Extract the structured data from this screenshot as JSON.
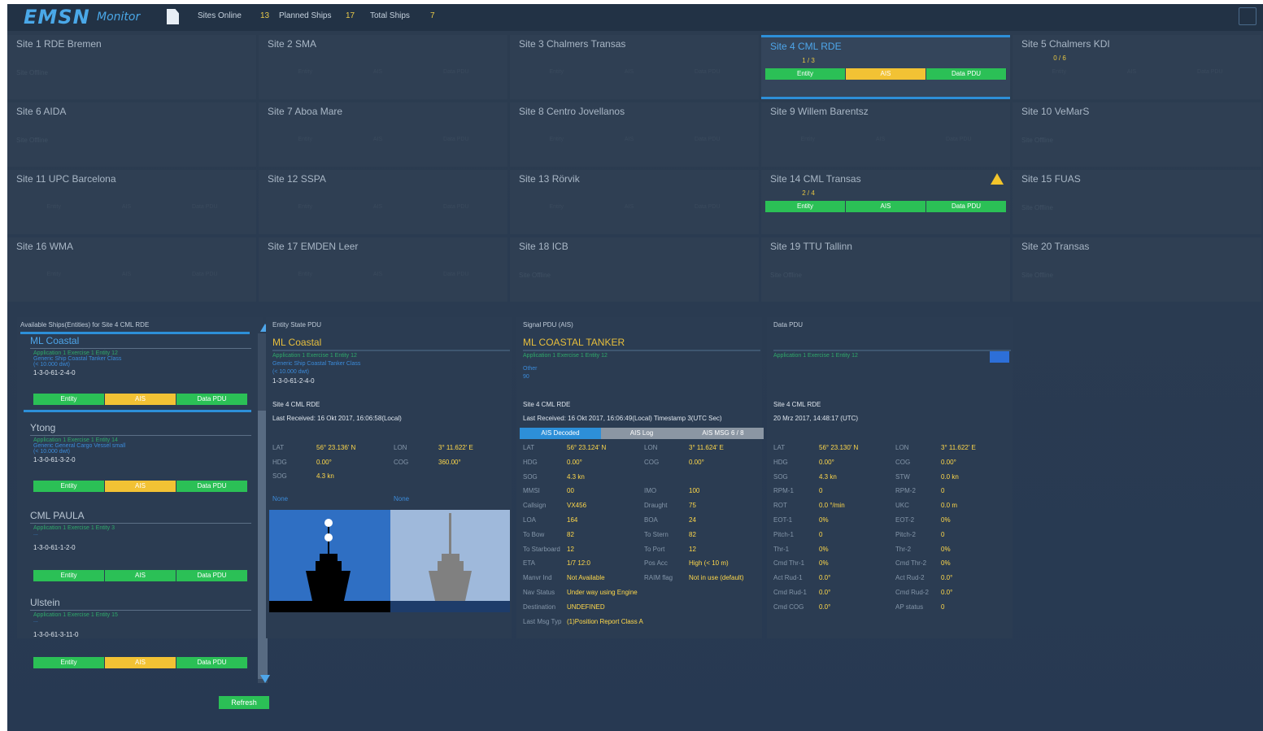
{
  "app": {
    "logo": "EMSN",
    "logo_sub": "Monitor",
    "stats": [
      {
        "label": "Sites Online",
        "value": "13"
      },
      {
        "label": "Planned Ships",
        "value": "17"
      },
      {
        "label": "Total Ships",
        "value": "7"
      }
    ]
  },
  "sites": [
    {
      "name": "Site 1 RDE Bremen",
      "status": "Site Offline"
    },
    {
      "name": "Site 2 SMA",
      "ghost": [
        "Entity",
        "AIS",
        "Data PDU"
      ]
    },
    {
      "name": "Site 3 Chalmers Transas",
      "ghost": [
        "Entity",
        "AIS",
        "Data PDU"
      ]
    },
    {
      "name": "Site 4 CML RDE",
      "frac": "1 / 3",
      "bar": [
        "Entity",
        "AIS",
        "Data PDU"
      ],
      "bar_colors": [
        "g",
        "y",
        "g"
      ]
    },
    {
      "name": "Site 5 Chalmers KDI",
      "frac": "0 / 6",
      "ghost": [
        "Entity",
        "AIS",
        "Data PDU"
      ]
    },
    {
      "name": "Site 6 AIDA",
      "status": "Site Offline"
    },
    {
      "name": "Site 7 Aboa Mare",
      "ghost": [
        "Entity",
        "AIS",
        "Data PDU"
      ]
    },
    {
      "name": "Site 8 Centro Jovellanos",
      "ghost": [
        "Entity",
        "AIS",
        "Data PDU"
      ]
    },
    {
      "name": "Site 9 Willem Barentsz",
      "ghost": [
        "Entity",
        "AIS",
        "Data PDU"
      ]
    },
    {
      "name": "Site 10 VeMarS",
      "status": "Site Offline"
    },
    {
      "name": "Site 11 UPC Barcelona",
      "ghost": [
        "Entity",
        "AIS",
        "Data PDU"
      ]
    },
    {
      "name": "Site 12 SSPA",
      "ghost": [
        "Entity",
        "AIS",
        "Data PDU"
      ]
    },
    {
      "name": "Site 13 Rörvik",
      "ghost": [
        "Entity",
        "AIS",
        "Data PDU"
      ]
    },
    {
      "name": "Site 14 CML Transas",
      "frac": "2 / 4",
      "bar": [
        "Entity",
        "AIS",
        "Data PDU"
      ],
      "bar_colors": [
        "g",
        "g",
        "g"
      ],
      "warn": true
    },
    {
      "name": "Site 15 FUAS",
      "status": "Site Offline"
    },
    {
      "name": "Site 16 WMA",
      "ghost": [
        "Entity",
        "AIS",
        "Data PDU"
      ]
    },
    {
      "name": "Site 17 EMDEN Leer",
      "ghost": [
        "Entity",
        "AIS",
        "Data PDU"
      ]
    },
    {
      "name": "Site 18 ICB",
      "status": "Site Offline"
    },
    {
      "name": "Site 19 TTU Tallinn",
      "status": "Site Offline"
    },
    {
      "name": "Site 20 Transas",
      "status": "Site Offline"
    }
  ],
  "list": {
    "title": "Available Ships(Entities) for Site 4 CML RDE",
    "refresh": "Refresh",
    "ships": [
      {
        "name": "ML Coastal",
        "sub": "Application 1  Exercise 1  Entity 12",
        "cls": "Generic Ship Coastal Tanker Class",
        "dwt": "(< 10.000 dwt)",
        "id": "1-3-0-61-2-4-0",
        "bar": [
          "Entity",
          "AIS",
          "Data PDU"
        ],
        "colors": [
          "g",
          "y",
          "g"
        ]
      },
      {
        "name": "Ytong",
        "sub": "Application 1  Exercise 1  Entity 14",
        "cls": "Generic General Cargo Vessel small",
        "dwt": "(< 10.000 dwt)",
        "id": "1-3-0-61-3-2-0",
        "bar": [
          "Entity",
          "AIS",
          "Data PDU"
        ],
        "colors": [
          "g",
          "y",
          "g"
        ]
      },
      {
        "name": "CML PAULA",
        "sub": "Application 1  Exercise 1  Entity 3",
        "cls": "...",
        "dwt": "",
        "id": "1-3-0-61-1-2-0",
        "bar": [
          "Entity",
          "AIS",
          "Data PDU"
        ],
        "colors": [
          "g",
          "g",
          "g"
        ]
      },
      {
        "name": "Ulstein",
        "sub": "Application 1  Exercise 1  Entity 15",
        "cls": "...",
        "dwt": "",
        "id": "1-3-0-61-3-11-0",
        "bar": [
          "Entity",
          "AIS",
          "Data PDU"
        ],
        "colors": [
          "g",
          "y",
          "g"
        ]
      }
    ]
  },
  "entity": {
    "header": "Entity State PDU",
    "title": "ML Coastal",
    "sub": "Application 1  Exercise 1  Entity 12",
    "cls": "Generic Ship Coastal Tanker Class",
    "dwt": "(< 10.000 dwt)",
    "id": "1-3-0-61-2-4-0",
    "site": "Site 4 CML RDE",
    "last": "Last Received: 16 Okt 2017, 16:06:58(Local)",
    "rows": [
      [
        "LAT",
        "56° 23.136' N",
        "LON",
        "3° 11.622' E"
      ],
      [
        "HDG",
        "0.00°",
        "COG",
        "360.00°"
      ],
      [
        "SOG",
        "4.3 kn",
        "",
        ""
      ]
    ],
    "view1": "None",
    "view2": "None"
  },
  "ais": {
    "header": "Signal PDU (AIS)",
    "title": "ML COASTAL TANKER",
    "sub": "Application 1  Exercise 1  Entity 12",
    "other": "Other",
    "other_val": "90",
    "site": "Site 4 CML RDE",
    "last": "Last Received: 16 Okt 2017, 16:06:49(Local) Timestamp 3(UTC Sec)",
    "tabs": [
      "AIS Decoded",
      "AIS Log",
      "AIS MSG 6 / 8"
    ],
    "rows": [
      [
        "LAT",
        "56° 23.124' N",
        "LON",
        "3° 11.624' E"
      ],
      [
        "HDG",
        "0.00°",
        "COG",
        "0.00°"
      ],
      [
        "SOG",
        "4.3 kn",
        "",
        ""
      ],
      [
        "MMSI",
        "00",
        "IMO",
        "100"
      ],
      [
        "Callsign",
        "VX456",
        "Draught",
        "75"
      ],
      [
        "LOA",
        "164",
        "BOA",
        "24"
      ],
      [
        "To Bow",
        "82",
        "To Stern",
        "82"
      ],
      [
        "To Starboard",
        "12",
        "To Port",
        "12"
      ],
      [
        "ETA",
        "1/7 12:0",
        "Pos Acc",
        "High (< 10 m)"
      ],
      [
        "Manvr Ind",
        "Not Available",
        "RAIM flag",
        "Not in use (default)"
      ],
      [
        "Nav Status",
        "Under way using Engine",
        "",
        ""
      ],
      [
        "Destination",
        "UNDEFINED",
        "",
        ""
      ],
      [
        "Last Msg Typ",
        "(1)Position Report Class A",
        "",
        ""
      ]
    ]
  },
  "datapdu": {
    "header": "Data PDU",
    "sub": "Application 1  Exercise 1  Entity 12",
    "site": "Site 4 CML RDE",
    "last": "20 Mrz 2017, 14:48:17 (UTC)",
    "rows": [
      [
        "LAT",
        "56° 23.130' N",
        "LON",
        "3° 11.622' E"
      ],
      [
        "HDG",
        "0.00°",
        "COG",
        "0.00°"
      ],
      [
        "SOG",
        "4.3 kn",
        "STW",
        "0.0 kn"
      ],
      [
        "RPM-1",
        "0",
        "RPM-2",
        "0"
      ],
      [
        "ROT",
        "0.0 °/min",
        "UKC",
        "0.0 m"
      ],
      [
        "EOT-1",
        "0%",
        "EOT-2",
        "0%"
      ],
      [
        "Pitch-1",
        "0",
        "Pitch-2",
        "0"
      ],
      [
        "Thr-1",
        "0%",
        "Thr-2",
        "0%"
      ],
      [
        "Cmd Thr-1",
        "0%",
        "Cmd Thr-2",
        "0%"
      ],
      [
        "Act Rud-1",
        "0.0°",
        "Act Rud-2",
        "0.0°"
      ],
      [
        "Cmd Rud-1",
        "0.0°",
        "Cmd Rud-2",
        "0.0°"
      ],
      [
        "Cmd COG",
        "0.0°",
        "AP status",
        "0"
      ]
    ]
  }
}
